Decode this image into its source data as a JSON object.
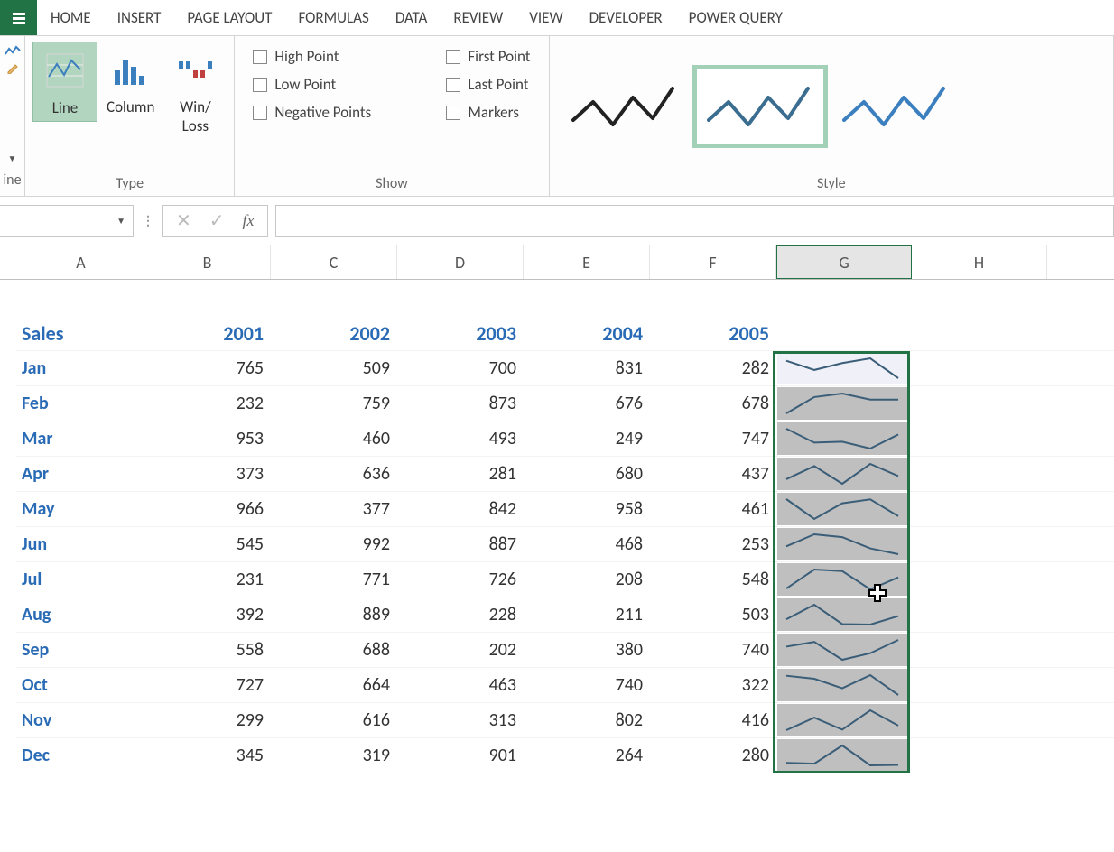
{
  "ribbon": {
    "tabs": [
      "HOME",
      "INSERT",
      "PAGE LAYOUT",
      "FORMULAS",
      "DATA",
      "REVIEW",
      "VIEW",
      "DEVELOPER",
      "POWER QUERY"
    ],
    "left_group_label": "ine",
    "type": {
      "label": "Type",
      "items": [
        {
          "id": "line",
          "label": "Line",
          "selected": true
        },
        {
          "id": "column",
          "label": "Column",
          "selected": false
        },
        {
          "id": "winloss",
          "label": "Win/\nLoss",
          "selected": false
        }
      ]
    },
    "show": {
      "label": "Show",
      "checks_col1": [
        "High Point",
        "Low Point",
        "Negative Points"
      ],
      "checks_col2": [
        "First Point",
        "Last Point",
        "Markers"
      ]
    },
    "style": {
      "label": "Style",
      "selected_index": 1
    }
  },
  "formula_bar": {
    "name_box": "",
    "fx": "fx",
    "value": ""
  },
  "columns": [
    "A",
    "B",
    "C",
    "D",
    "E",
    "F",
    "G",
    "H"
  ],
  "selected_column": "G",
  "table": {
    "corner": "Sales",
    "year_headers": [
      "2001",
      "2002",
      "2003",
      "2004",
      "2005"
    ],
    "rows": [
      {
        "label": "Jan",
        "v": [
          765,
          509,
          700,
          831,
          282
        ]
      },
      {
        "label": "Feb",
        "v": [
          232,
          759,
          873,
          676,
          678
        ]
      },
      {
        "label": "Mar",
        "v": [
          953,
          460,
          493,
          249,
          747
        ]
      },
      {
        "label": "Apr",
        "v": [
          373,
          636,
          281,
          680,
          437
        ]
      },
      {
        "label": "May",
        "v": [
          966,
          377,
          842,
          958,
          461
        ]
      },
      {
        "label": "Jun",
        "v": [
          545,
          992,
          887,
          468,
          253
        ]
      },
      {
        "label": "Jul",
        "v": [
          231,
          771,
          726,
          208,
          548
        ]
      },
      {
        "label": "Aug",
        "v": [
          392,
          889,
          228,
          211,
          503
        ]
      },
      {
        "label": "Sep",
        "v": [
          558,
          688,
          202,
          380,
          740
        ]
      },
      {
        "label": "Oct",
        "v": [
          727,
          664,
          463,
          740,
          322
        ]
      },
      {
        "label": "Nov",
        "v": [
          299,
          616,
          313,
          802,
          416
        ]
      },
      {
        "label": "Dec",
        "v": [
          345,
          319,
          901,
          264,
          280
        ]
      }
    ]
  },
  "chart_data": {
    "type": "line",
    "note": "Sparklines in column G — one mini line chart per month across years 2001–2005",
    "x": [
      "2001",
      "2002",
      "2003",
      "2004",
      "2005"
    ],
    "series": [
      {
        "name": "Jan",
        "values": [
          765,
          509,
          700,
          831,
          282
        ]
      },
      {
        "name": "Feb",
        "values": [
          232,
          759,
          873,
          676,
          678
        ]
      },
      {
        "name": "Mar",
        "values": [
          953,
          460,
          493,
          249,
          747
        ]
      },
      {
        "name": "Apr",
        "values": [
          373,
          636,
          281,
          680,
          437
        ]
      },
      {
        "name": "May",
        "values": [
          966,
          377,
          842,
          958,
          461
        ]
      },
      {
        "name": "Jun",
        "values": [
          545,
          992,
          887,
          468,
          253
        ]
      },
      {
        "name": "Jul",
        "values": [
          231,
          771,
          726,
          208,
          548
        ]
      },
      {
        "name": "Aug",
        "values": [
          392,
          889,
          228,
          211,
          503
        ]
      },
      {
        "name": "Sep",
        "values": [
          558,
          688,
          202,
          380,
          740
        ]
      },
      {
        "name": "Oct",
        "values": [
          727,
          664,
          463,
          740,
          322
        ]
      },
      {
        "name": "Nov",
        "values": [
          299,
          616,
          313,
          802,
          416
        ]
      },
      {
        "name": "Dec",
        "values": [
          345,
          319,
          901,
          264,
          280
        ]
      }
    ]
  }
}
